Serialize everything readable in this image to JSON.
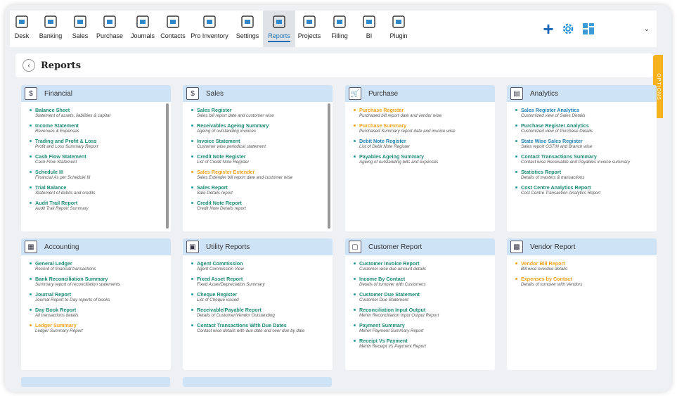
{
  "nav": [
    {
      "label": "Desk",
      "icon": "desk-icon"
    },
    {
      "label": "Banking",
      "icon": "bank-icon"
    },
    {
      "label": "Sales",
      "icon": "sales-icon"
    },
    {
      "label": "Purchase",
      "icon": "purchase-icon"
    },
    {
      "label": "Journals",
      "icon": "journals-icon"
    },
    {
      "label": "Contacts",
      "icon": "contacts-icon"
    },
    {
      "label": "Pro Inventory",
      "icon": "inventory-icon"
    },
    {
      "label": "Settings",
      "icon": "settings-icon"
    },
    {
      "label": "Reports",
      "icon": "reports-icon",
      "active": true
    },
    {
      "label": "Projects",
      "icon": "projects-icon"
    },
    {
      "label": "Filling",
      "icon": "filling-icon"
    },
    {
      "label": "BI",
      "icon": "bi-icon"
    },
    {
      "label": "Plugin",
      "icon": "plugin-icon"
    }
  ],
  "page": {
    "title": "Reports",
    "options": "OPTIONS"
  },
  "colors": {
    "accent": "#1f6fb2",
    "header": "#cfe3f7",
    "orange": "#f0a21e",
    "green": "#1d8a76",
    "tab": "#f5b21c"
  },
  "cards": {
    "financial": {
      "title": "Financial",
      "items": [
        {
          "t": "Balance Sheet",
          "d": "Statement of assets, liabilities & capital"
        },
        {
          "t": "Income Statement",
          "d": "Revenues & Expenses"
        },
        {
          "t": "Trading and Profit & Loss",
          "d": "Profit and Loss Summary Report"
        },
        {
          "t": "Cash Flow Statement",
          "d": "Cash Flow Statement"
        },
        {
          "t": "Schedule III",
          "d": "Financial As per Schedule III"
        },
        {
          "t": "Trial Balance",
          "d": "Statement of debits and credits"
        },
        {
          "t": "Audit Trail Report",
          "d": "Audit Trail Report Summary"
        }
      ]
    },
    "sales": {
      "title": "Sales",
      "items": [
        {
          "t": "Sales Register",
          "d": "Sales bill report date and customer wise"
        },
        {
          "t": "Receivables Ageing Summary",
          "d": "Ageing of outstanding invoices"
        },
        {
          "t": "Invoice Statement",
          "d": "Customer wise periodical statement"
        },
        {
          "t": "Credit Note Register",
          "d": "List of Credit Note Register"
        },
        {
          "t": "Sales Register Extender",
          "d": "Sales Extender bill report date and customer wise",
          "c": "orange"
        },
        {
          "t": "Sales Report",
          "d": "Sale Details report"
        },
        {
          "t": "Credit Note Report",
          "d": "Credit Note Details report"
        }
      ]
    },
    "purchase": {
      "title": "Purchase",
      "items": [
        {
          "t": "Purchase Register",
          "d": "Purchased bill report date and vendor wise",
          "c": "orange"
        },
        {
          "t": "Purchase Summary",
          "d": "Purchased Summary report date and invoice wise",
          "c": "orange"
        },
        {
          "t": "Debit Note Register",
          "d": "List of Debit Note Register",
          "c": "blue"
        },
        {
          "t": "Payables Ageing Summary",
          "d": "Ageing of outstanding bills and expenses"
        }
      ]
    },
    "analytics": {
      "title": "Analytics",
      "items": [
        {
          "t": "Sales Register Analytics",
          "d": "Customized view of Sales Details",
          "c": "blue"
        },
        {
          "t": "Purchase Register Analytics",
          "d": "Customized view of Purchase Details"
        },
        {
          "t": "State Wise Sales Register",
          "d": "Sales report GSTIN and Branch wise",
          "c": "blue"
        },
        {
          "t": "Contact Transactions Summary",
          "d": "Contact wise Receivable and Payables invoice summary"
        },
        {
          "t": "Statistics Report",
          "d": "Details of masters & transactions"
        },
        {
          "t": "Cost Centre Analytics Report",
          "d": "Cost Centre Transaction Analytics Report"
        }
      ]
    },
    "accounting": {
      "title": "Accounting",
      "items": [
        {
          "t": "General Ledger",
          "d": "Record of financial transactions"
        },
        {
          "t": "Bank Reconciliation Summary",
          "d": "Summary report of reconciliation statements"
        },
        {
          "t": "Journal Report",
          "d": "Journal Report to Day reports of books"
        },
        {
          "t": "Day Book Report",
          "d": "All transactions details"
        },
        {
          "t": "Ledger Summary",
          "d": "Ledger Summary Report",
          "c": "orange"
        }
      ]
    },
    "utility": {
      "title": "Utility Reports",
      "items": [
        {
          "t": "Agent Commission",
          "d": "Agent Commission View"
        },
        {
          "t": "Fixed Asset Report",
          "d": "Fixed Asset/Depreciation Summary"
        },
        {
          "t": "Cheque Register",
          "d": "List of Cheque issued"
        },
        {
          "t": "Receivable/Payable Report",
          "d": "Details of Customer/Vendor Outstanding"
        },
        {
          "t": "Contact Transactions With Due Dates",
          "d": "Contact wise details with due date and over due by date"
        }
      ]
    },
    "customer": {
      "title": "Customer Report",
      "items": [
        {
          "t": "Customer Invoice Report",
          "d": "Customer wise due amount details"
        },
        {
          "t": "Income By Contact",
          "d": "Details of turnover with Customers"
        },
        {
          "t": "Customer Due Statement",
          "d": "Customer Due Statement"
        },
        {
          "t": "Reconciliation Input Output",
          "d": "Mehin Reconciliation Input Output Report"
        },
        {
          "t": "Payment Summary",
          "d": "Mehin Payment Summary Report"
        },
        {
          "t": "Receipt Vs Payment",
          "d": "Mehin Receipt Vs Payment Report"
        }
      ]
    },
    "vendor": {
      "title": "Vendor Report",
      "items": [
        {
          "t": "Vendor Bill Report",
          "d": "Bill wise overdue details",
          "c": "orange"
        },
        {
          "t": "Expenses by Contact",
          "d": "Details of turnover with Vendors",
          "c": "orange"
        }
      ]
    }
  }
}
